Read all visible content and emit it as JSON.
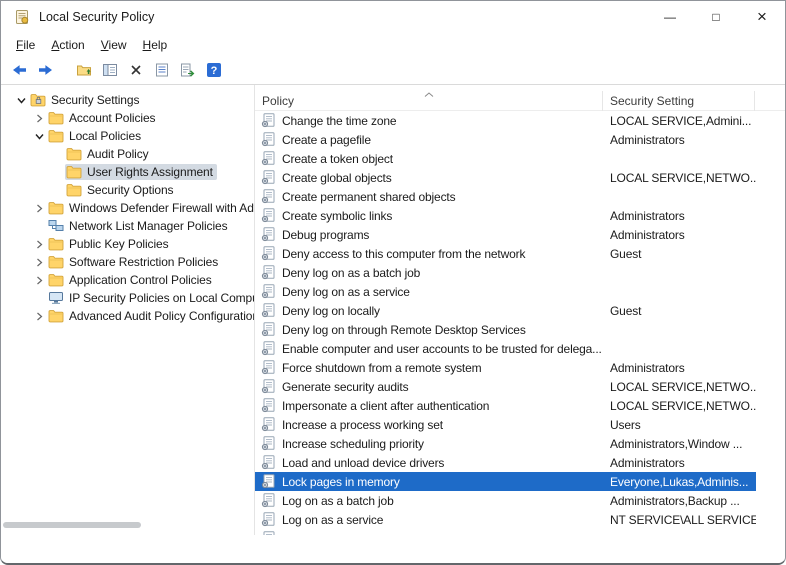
{
  "window": {
    "title": "Local Security Policy",
    "icons": {
      "minimize": "—",
      "maximize": "□",
      "close": "×"
    }
  },
  "menu": {
    "items": [
      {
        "label": "File"
      },
      {
        "label": "Action"
      },
      {
        "label": "View"
      },
      {
        "label": "Help"
      }
    ]
  },
  "toolbar": {
    "buttons": [
      {
        "name": "back-button",
        "icon": "arrow-left"
      },
      {
        "name": "forward-button",
        "icon": "arrow-right"
      },
      {
        "type": "separator"
      },
      {
        "name": "up-one-level-button",
        "icon": "folder-up"
      },
      {
        "name": "show-hide-console-tree-button",
        "icon": "console-tree"
      },
      {
        "name": "delete-button",
        "icon": "delete-x"
      },
      {
        "name": "properties-button",
        "icon": "properties-list"
      },
      {
        "name": "export-list-button",
        "icon": "export-list"
      },
      {
        "name": "help-button",
        "icon": "help",
        "glyph": "?"
      }
    ]
  },
  "tree": {
    "items": [
      {
        "label": "Security Settings",
        "level": 0,
        "chevron": "expanded",
        "icon": "security-folder-icon",
        "selected": false
      },
      {
        "label": "Account Policies",
        "level": 1,
        "chevron": "collapsed",
        "icon": "folder-icon",
        "selected": false
      },
      {
        "label": "Local Policies",
        "level": 1,
        "chevron": "expanded",
        "icon": "folder-icon",
        "selected": false
      },
      {
        "label": "Audit Policy",
        "level": 2,
        "chevron": "none",
        "icon": "folder-icon",
        "selected": false
      },
      {
        "label": "User Rights Assignment",
        "level": 2,
        "chevron": "none",
        "icon": "folder-icon",
        "selected": true
      },
      {
        "label": "Security Options",
        "level": 2,
        "chevron": "none",
        "icon": "folder-icon",
        "selected": false
      },
      {
        "label": "Windows Defender Firewall with Adva",
        "level": 1,
        "chevron": "collapsed",
        "icon": "folder-icon",
        "selected": false
      },
      {
        "label": "Network List Manager Policies",
        "level": 1,
        "chevron": "none",
        "icon": "network-icon",
        "selected": false
      },
      {
        "label": "Public Key Policies",
        "level": 1,
        "chevron": "collapsed",
        "icon": "folder-icon",
        "selected": false
      },
      {
        "label": "Software Restriction Policies",
        "level": 1,
        "chevron": "collapsed",
        "icon": "folder-icon",
        "selected": false
      },
      {
        "label": "Application Control Policies",
        "level": 1,
        "chevron": "collapsed",
        "icon": "folder-icon",
        "selected": false
      },
      {
        "label": "IP Security Policies on Local Compute",
        "level": 1,
        "chevron": "none",
        "icon": "computer-icon",
        "selected": false
      },
      {
        "label": "Advanced Audit Policy Configuration",
        "level": 1,
        "chevron": "collapsed",
        "icon": "folder-icon",
        "selected": false
      }
    ]
  },
  "list": {
    "columns": [
      {
        "label": "Policy",
        "sort": "ascending"
      },
      {
        "label": "Security Setting",
        "sort": null
      }
    ],
    "selected_index": 19,
    "partial_next_row": true,
    "rows": [
      {
        "policy": "Change the time zone",
        "setting": "LOCAL SERVICE,Admini..."
      },
      {
        "policy": "Create a pagefile",
        "setting": "Administrators"
      },
      {
        "policy": "Create a token object",
        "setting": ""
      },
      {
        "policy": "Create global objects",
        "setting": "LOCAL SERVICE,NETWO..."
      },
      {
        "policy": "Create permanent shared objects",
        "setting": ""
      },
      {
        "policy": "Create symbolic links",
        "setting": "Administrators"
      },
      {
        "policy": "Debug programs",
        "setting": "Administrators"
      },
      {
        "policy": "Deny access to this computer from the network",
        "setting": "Guest"
      },
      {
        "policy": "Deny log on as a batch job",
        "setting": ""
      },
      {
        "policy": "Deny log on as a service",
        "setting": ""
      },
      {
        "policy": "Deny log on locally",
        "setting": "Guest"
      },
      {
        "policy": "Deny log on through Remote Desktop Services",
        "setting": ""
      },
      {
        "policy": "Enable computer and user accounts to be trusted for delega...",
        "setting": ""
      },
      {
        "policy": "Force shutdown from a remote system",
        "setting": "Administrators"
      },
      {
        "policy": "Generate security audits",
        "setting": "LOCAL SERVICE,NETWO..."
      },
      {
        "policy": "Impersonate a client after authentication",
        "setting": "LOCAL SERVICE,NETWO..."
      },
      {
        "policy": "Increase a process working set",
        "setting": "Users"
      },
      {
        "policy": "Increase scheduling priority",
        "setting": "Administrators,Window ..."
      },
      {
        "policy": "Load and unload device drivers",
        "setting": "Administrators"
      },
      {
        "policy": "Lock pages in memory",
        "setting": "Everyone,Lukas,Adminis..."
      },
      {
        "policy": "Log on as a batch job",
        "setting": "Administrators,Backup ..."
      },
      {
        "policy": "Log on as a service",
        "setting": "NT SERVICE\\ALL SERVICES"
      }
    ]
  },
  "colors": {
    "list_selection": "#1e6bc8",
    "list_selection_text": "#ffffff",
    "tree_selection": "#d3dae2",
    "accent_blue": "#2b6cd4"
  }
}
